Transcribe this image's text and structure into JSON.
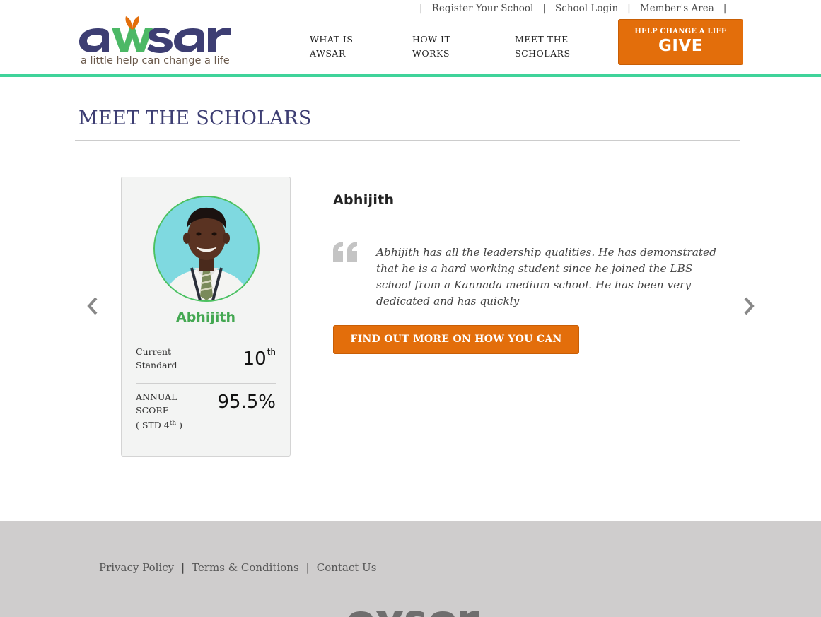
{
  "brand": {
    "logo_text": "awsar",
    "tagline": "a little help can change a life",
    "primary_color": "#3d3e73",
    "accent_color": "#e36e0b",
    "green_color": "#3fd39a"
  },
  "top_links": [
    {
      "label": "Register Your School"
    },
    {
      "label": "School Login"
    },
    {
      "label": "Member's Area"
    }
  ],
  "nav": [
    {
      "label": "WHAT IS AWSAR"
    },
    {
      "label": "HOW IT WORKS"
    },
    {
      "label": "MEET THE SCHOLARS"
    }
  ],
  "give_button": {
    "top_text": "HELP CHANGE A LIFE",
    "main_text": "GIVE"
  },
  "page": {
    "title": "MEET THE SCHOLARS"
  },
  "scholar": {
    "name": "Abhijith",
    "standard_label_1": "Current",
    "standard_label_2": "Standard",
    "standard_value": "10",
    "standard_suffix": "th",
    "score_label_1": "ANNUAL",
    "score_label_2": "SCORE",
    "score_label_3_prefix": "( STD 4",
    "score_label_3_sup": "th",
    "score_label_3_suffix": " )",
    "score_value": "95.5%",
    "quote": "Abhijith has all the leadership qualities. He has demonstrated that he is a hard working student since he joined the LBS school from a Kannada medium school. He has been very dedicated and has quickly",
    "cta_label": "FIND OUT MORE ON HOW YOU CAN HELP"
  },
  "carousel": {
    "prev_icon": "chevron-left-icon",
    "next_icon": "chevron-right-icon"
  },
  "footer": {
    "links": [
      {
        "label": "Privacy Policy"
      },
      {
        "label": "Terms & Conditions"
      },
      {
        "label": "Contact Us"
      }
    ]
  }
}
